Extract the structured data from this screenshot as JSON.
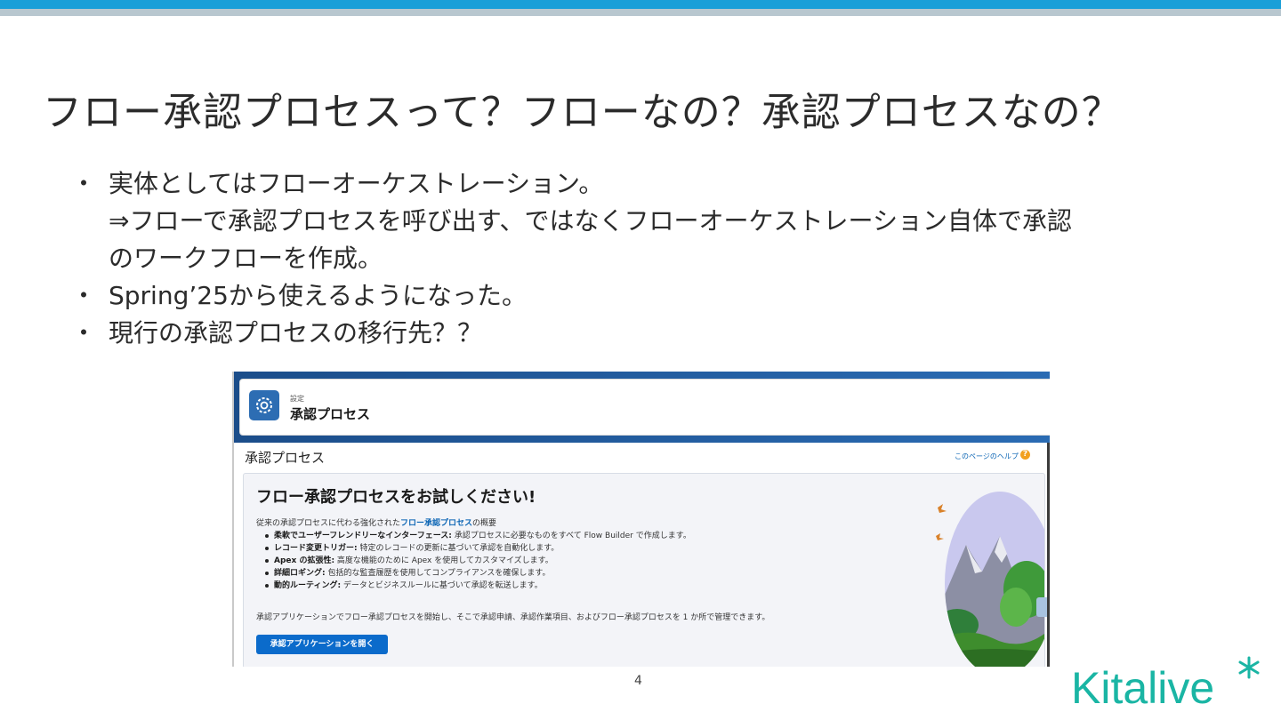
{
  "slide": {
    "title": "フロー承認プロセスって？フローなの？承認プロセスなの？",
    "bullet_mark": "・",
    "bullets": [
      {
        "text": "実体としてはフローオーケストレーション。"
      },
      {
        "text": "Spring’25から使えるようになった。"
      },
      {
        "text": "現行の承認プロセスの移行先？？"
      }
    ],
    "continuation_1": "⇒フローで承認プロセスを呼び出す、ではなくフローオーケストレーション自体で承認",
    "continuation_2": "のワークフローを作成。",
    "page_number": "4",
    "logo_text": "Kitalive"
  },
  "screenshot": {
    "breadcrumb": "設定",
    "header_title": "承認プロセス",
    "page_title": "承認プロセス",
    "help_link": "このページのヘルプ",
    "help_icon": "?",
    "card_title": "フロー承認プロセスをお試しください!",
    "intro_prefix": "従来の承認プロセスに代わる強化された",
    "intro_link": "フロー承認プロセス",
    "intro_suffix": "の概要",
    "features": [
      {
        "bold": "柔軟でユーザーフレンドリーなインターフェース:",
        "text": " 承認プロセスに必要なものをすべて Flow Builder で作成します。"
      },
      {
        "bold": "レコード変更トリガー:",
        "text": " 特定のレコードの更新に基づいて承認を自動化します。"
      },
      {
        "bold": "Apex の拡張性:",
        "text": " 高度な機能のために Apex を使用してカスタマイズします。"
      },
      {
        "bold": "詳細ロギング:",
        "text": " 包括的な監査履歴を使用してコンプライアンスを確保します。"
      },
      {
        "bold": "動的ルーティング:",
        "text": " データとビジネスルールに基づいて承認を転送します。"
      }
    ],
    "footnote": "承認アプリケーションでフロー承認プロセスを開始し、そこで承認申請、承認作業項目、およびフロー承認プロセスを 1 か所で管理できます。",
    "open_button": "承認アプリケーションを開く"
  },
  "colors": {
    "accent_blue": "#1a9fd8",
    "salesforce_blue": "#0b6bcb",
    "logo_green": "#1ab5a4"
  }
}
